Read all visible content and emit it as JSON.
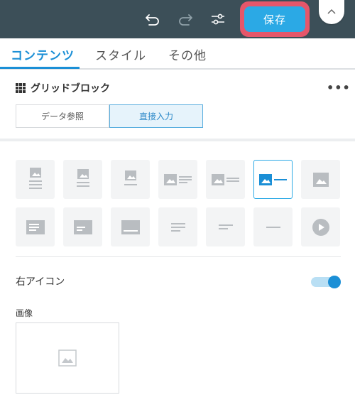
{
  "toolbar": {
    "undo_icon": "undo-icon",
    "redo_icon": "redo-icon",
    "settings_icon": "sliders-icon",
    "save_label": "保存",
    "collapse_icon": "chevron-up-icon"
  },
  "tabs": [
    {
      "label": "コンテンツ",
      "active": true
    },
    {
      "label": "スタイル",
      "active": false
    },
    {
      "label": "その他",
      "active": false
    }
  ],
  "block": {
    "icon": "grid-icon",
    "title": "グリッドブロック",
    "more_label": "•••"
  },
  "source_mode": {
    "options": [
      "データ参照",
      "直接入力"
    ],
    "selected": "直接入力"
  },
  "layouts": {
    "selected_index": 5,
    "row1": [
      "image-top-text",
      "image-top-text-short",
      "image-top-line",
      "image-left-text",
      "image-left-text-short",
      "image-left-line",
      "image-only"
    ],
    "row2": [
      "text-block",
      "text-block-short",
      "line-block",
      "text-lines",
      "text-line-short",
      "line-only",
      "video"
    ]
  },
  "right_icon": {
    "label": "右アイコン",
    "enabled": true
  },
  "image": {
    "label": "画像",
    "placeholder_icon": "image-placeholder-icon"
  },
  "colors": {
    "topbar": "#3c4f58",
    "accent": "#1b8fd6",
    "save_button": "#2ba9e5",
    "save_highlight": "#e5566a"
  }
}
